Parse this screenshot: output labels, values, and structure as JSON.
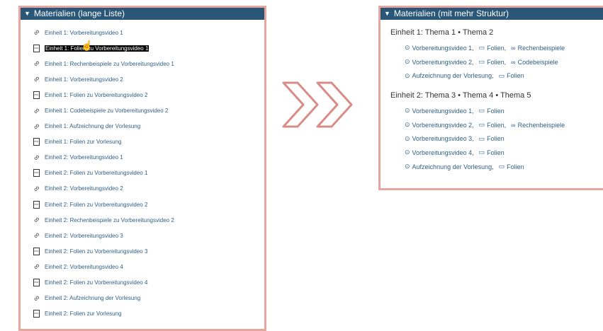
{
  "left_panel": {
    "title": "Materialien (lange Liste)",
    "items": [
      {
        "type": "link",
        "label": "Einheit 1: Vorbereitungsvideo 1"
      },
      {
        "type": "pdf",
        "label": "Einheit 1: Folien zu Vorbereitungsvideo 1",
        "selected": true
      },
      {
        "type": "link",
        "label": "Einheit 1: Rechenbeispiele zu Vorbereitungsvideo 1"
      },
      {
        "type": "link",
        "label": "Einheit 1: Vorbereitungsvideo 2"
      },
      {
        "type": "pdf",
        "label": "Einheit 1: Folien zu Vorbereitungsvideo 2"
      },
      {
        "type": "link",
        "label": "Einheit 1: Codebeispiele zu Vorbereitungsvideo 2"
      },
      {
        "type": "link",
        "label": "Einheit 1: Aufzeichnung der Vorlesung"
      },
      {
        "type": "pdf",
        "label": "Einheit 1: Folien zur Vorlesung"
      },
      {
        "type": "link",
        "label": "Einheit 2: Vorbereitungsvideo 1"
      },
      {
        "type": "pdf",
        "label": "Einheit 2: Folien zu Vorbereitungsvideo 1"
      },
      {
        "type": "link",
        "label": "Einheit 2: Vorbereitungsvideo 2"
      },
      {
        "type": "pdf",
        "label": "Einheit 2: Folien zu Vorbereitungsvideo 2"
      },
      {
        "type": "link",
        "label": "Einheit 2: Rechenbeispiele zu Vorbereitungsvideo 2"
      },
      {
        "type": "link",
        "label": "Einheit 2: Vorbereitungsvideo 3"
      },
      {
        "type": "pdf",
        "label": "Einheit 2: Folien zu Vorbereitungsvideo 3"
      },
      {
        "type": "link",
        "label": "Einheit 2: Vorbereitungsvideo 4"
      },
      {
        "type": "pdf",
        "label": "Einheit 2: Folien zu Vorbereitungsvideo 4"
      },
      {
        "type": "link",
        "label": "Einheit 2: Aufzeichnung der Vorlesung"
      },
      {
        "type": "pdf",
        "label": "Einheit 2: Folien zur Vorlesung"
      }
    ]
  },
  "right_panel": {
    "title": "Materialien (mit mehr Struktur)",
    "groups": [
      {
        "title": "Einheit 1: Thema 1 • Thema 2",
        "rows": [
          [
            {
              "icon": "play",
              "label": "Vorbereitungsvideo 1"
            },
            {
              "icon": "slides",
              "label": "Folien"
            },
            {
              "icon": "link",
              "label": "Rechenbeispiele"
            }
          ],
          [
            {
              "icon": "play",
              "label": "Vorbereitungsvideo 2"
            },
            {
              "icon": "slides",
              "label": "Folien"
            },
            {
              "icon": "link",
              "label": "Codebeispiele"
            }
          ],
          [
            {
              "icon": "play",
              "label": "Aufzeichnung der Vorlesung"
            },
            {
              "icon": "slides",
              "label": "Folien"
            }
          ]
        ]
      },
      {
        "title": "Einheit 2: Thema 3 • Thema 4 • Thema 5",
        "rows": [
          [
            {
              "icon": "play",
              "label": "Vorbereitungsvideo 1"
            },
            {
              "icon": "slides",
              "label": "Folien"
            }
          ],
          [
            {
              "icon": "play",
              "label": "Vorbereitungsvideo 2"
            },
            {
              "icon": "slides",
              "label": "Folien"
            },
            {
              "icon": "link",
              "label": "Rechenbeispiele"
            }
          ],
          [
            {
              "icon": "play",
              "label": "Vorbereitungsvideo 3"
            },
            {
              "icon": "slides",
              "label": "Folien"
            }
          ],
          [
            {
              "icon": "play",
              "label": "Vorbereitungsvideo 4"
            },
            {
              "icon": "slides",
              "label": "Folien"
            }
          ],
          [
            {
              "icon": "play",
              "label": "Aufzeichnung der Vorlesung"
            },
            {
              "icon": "slides",
              "label": "Folien"
            }
          ]
        ]
      }
    ]
  },
  "colors": {
    "header_bg": "#2a5678",
    "border": "#e6a6a0",
    "link": "#2f5f86",
    "arrow": "#d98c85"
  }
}
